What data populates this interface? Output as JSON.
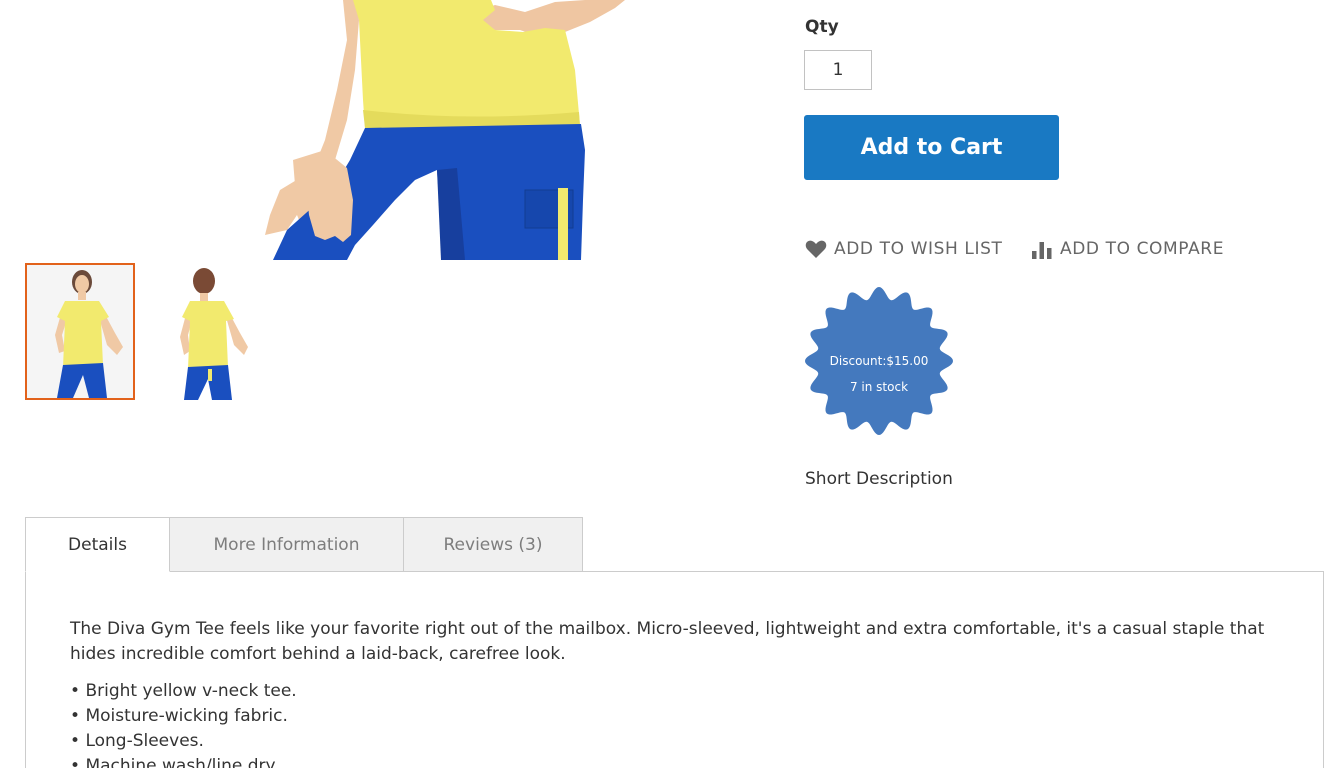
{
  "product": {
    "qty_label": "Qty",
    "qty_value": "1",
    "add_to_cart_label": "Add to Cart",
    "wishlist_label": "ADD TO WISH LIST",
    "compare_label": "ADD TO COMPARE",
    "badge": {
      "discount": "Discount:$15.00",
      "stock": "7 in stock",
      "color": "#4479be"
    },
    "short_description_label": "Short Description"
  },
  "gallery": {
    "active_thumb_border": "#e2621b",
    "thumbnails": [
      "front-view",
      "back-view"
    ]
  },
  "tabs": [
    {
      "label": "Details",
      "active": true
    },
    {
      "label": "More Information",
      "active": false
    },
    {
      "label": "Reviews (3)",
      "active": false
    }
  ],
  "details": {
    "paragraph": "The Diva Gym Tee feels like your favorite right out of the mailbox. Micro-sleeved, lightweight and extra comfortable, it's a casual staple that hides incredible comfort behind a laid-back, carefree look.",
    "bullets": [
      "Bright yellow v-neck tee.",
      "Moisture-wicking fabric.",
      "Long-Sleeves.",
      "Machine wash/line dry."
    ]
  },
  "colors": {
    "primary_button": "#1979c3",
    "shirt": "#f2ea6e",
    "pants": "#1a4fbf"
  }
}
